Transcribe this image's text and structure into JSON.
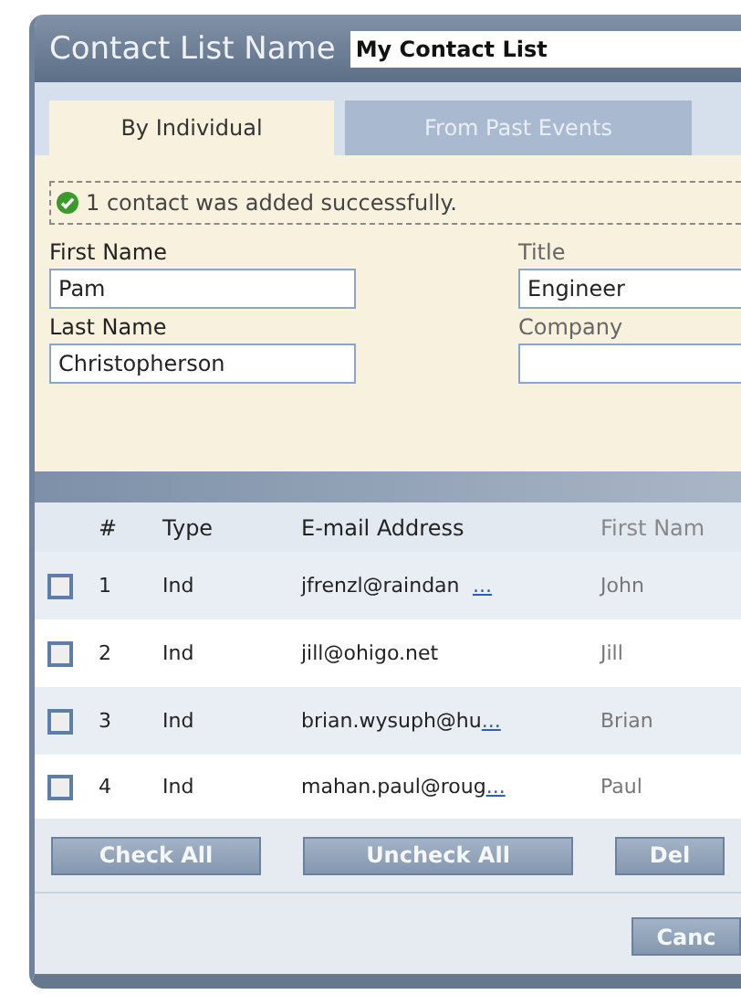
{
  "title_label": "Contact List Name",
  "list_name": "My Contact List",
  "tabs": [
    {
      "label": "By Individual",
      "selected": true
    },
    {
      "label": "From Past Events",
      "selected": false
    }
  ],
  "message": {
    "text": "1 contact was added successfully."
  },
  "fields": [
    {
      "label": "First Name",
      "value": "Pam"
    },
    {
      "label": "Title",
      "value": "Engineer"
    },
    {
      "label": "Last Name",
      "value": "Christopherson"
    },
    {
      "label": "Company"
    }
  ],
  "table": {
    "columns": [
      "#",
      "Type",
      "E-mail Address",
      "First Nam"
    ],
    "rows": [
      {
        "checked": false,
        "number": "1",
        "type": "Ind",
        "email": "jfrenzl@raindan",
        "more": "...",
        "first_name": "John"
      },
      {
        "checked": false,
        "number": "2",
        "type": "Ind",
        "email": "jill@ohigo.net",
        "first_name": "Jill"
      },
      {
        "checked": false,
        "number": "3",
        "type": "Ind",
        "email": "brian.wysuph@hu",
        "more": "...",
        "first_name": "Brian"
      },
      {
        "checked": false,
        "number": "4",
        "type": "Ind",
        "email": "mahan.paul@roug",
        "more": "...",
        "first_name": "Paul"
      }
    ]
  },
  "buttons": [
    "Check All",
    "Uncheck All",
    "Del"
  ],
  "footer_buttons": [
    "Canc"
  ]
}
